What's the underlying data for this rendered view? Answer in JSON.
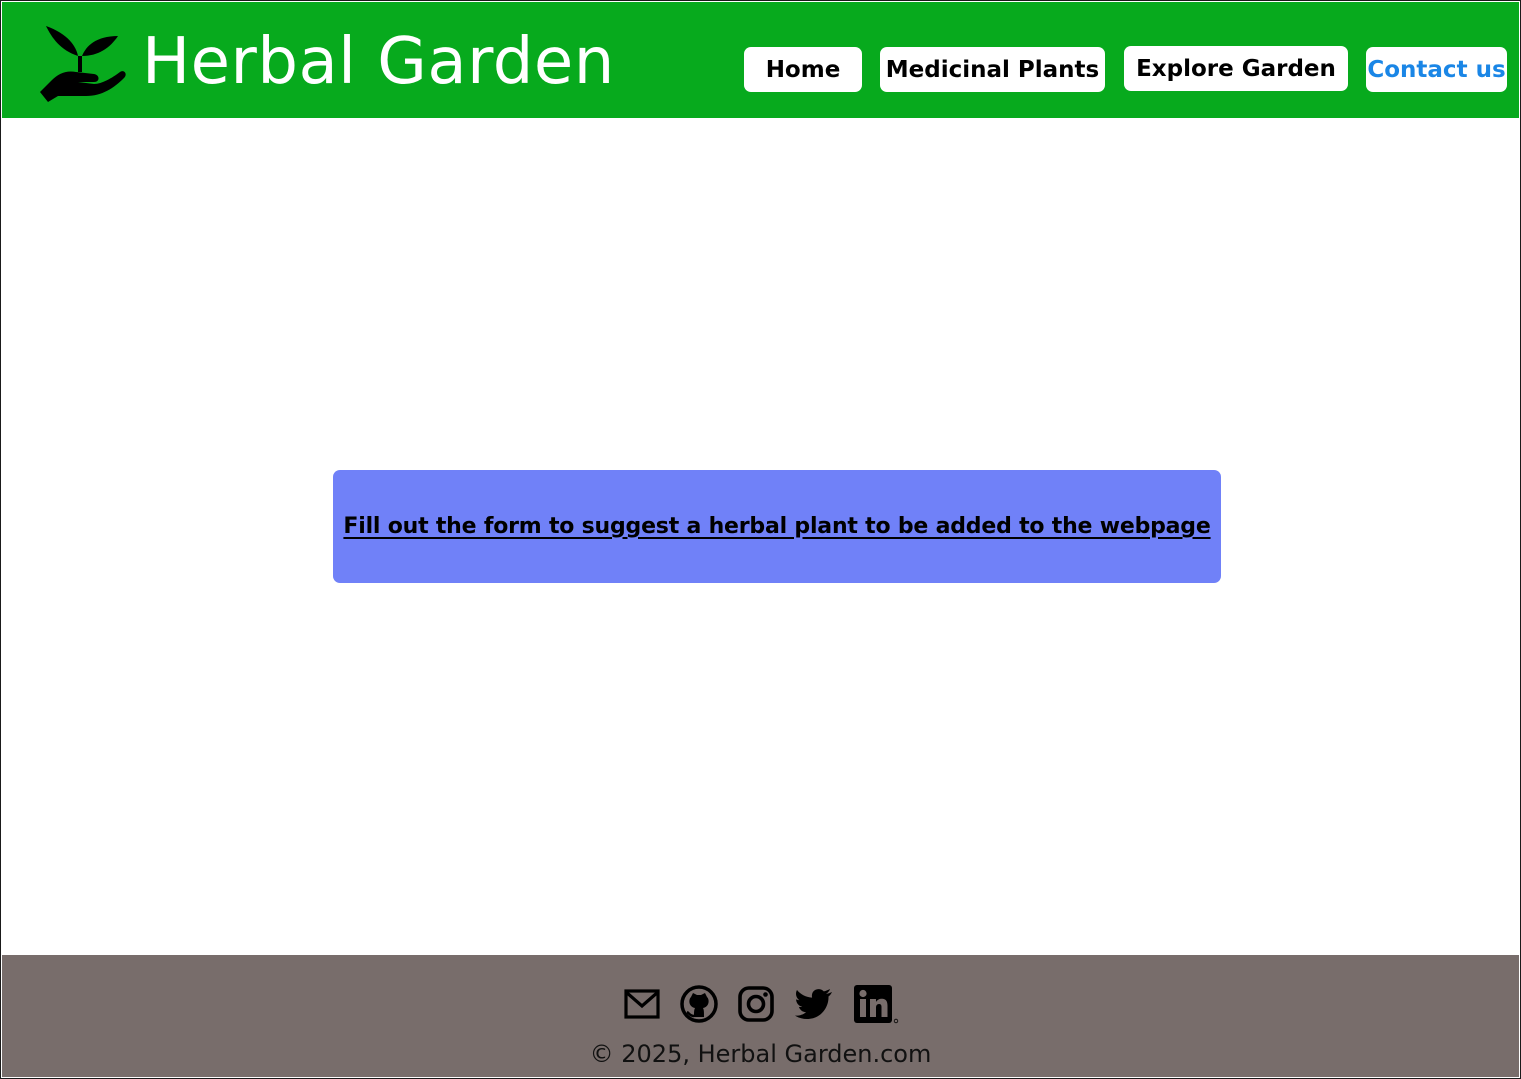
{
  "header": {
    "logo_icon": "hand-holding-sprout-icon",
    "title": "Herbal Garden",
    "background_color": "#07aa1d"
  },
  "nav": {
    "home": "Home",
    "medicinal_plants": "Medicinal Plants",
    "explore_garden": "Explore Garden",
    "contact_us": "Contact us",
    "active_color": "#1a86e6"
  },
  "main": {
    "banner_text": "Fill out the form to suggest a herbal plant to be added to the webpage",
    "banner_color": "#7081f8"
  },
  "footer": {
    "icons": [
      "mail-icon",
      "github-icon",
      "instagram-icon",
      "twitter-icon",
      "linkedin-icon"
    ],
    "copyright": "© 2025, Herbal Garden.com",
    "background_color": "#786d6b"
  }
}
